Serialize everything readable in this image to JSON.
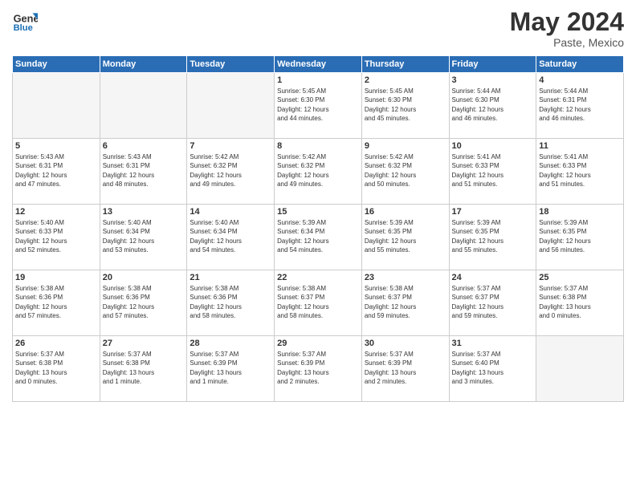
{
  "header": {
    "logo_general": "General",
    "logo_blue": "Blue",
    "month_year": "May 2024",
    "location": "Paste, Mexico"
  },
  "days_of_week": [
    "Sunday",
    "Monday",
    "Tuesday",
    "Wednesday",
    "Thursday",
    "Friday",
    "Saturday"
  ],
  "weeks": [
    [
      {
        "day": "",
        "info": ""
      },
      {
        "day": "",
        "info": ""
      },
      {
        "day": "",
        "info": ""
      },
      {
        "day": "1",
        "info": "Sunrise: 5:45 AM\nSunset: 6:30 PM\nDaylight: 12 hours\nand 44 minutes."
      },
      {
        "day": "2",
        "info": "Sunrise: 5:45 AM\nSunset: 6:30 PM\nDaylight: 12 hours\nand 45 minutes."
      },
      {
        "day": "3",
        "info": "Sunrise: 5:44 AM\nSunset: 6:30 PM\nDaylight: 12 hours\nand 46 minutes."
      },
      {
        "day": "4",
        "info": "Sunrise: 5:44 AM\nSunset: 6:31 PM\nDaylight: 12 hours\nand 46 minutes."
      }
    ],
    [
      {
        "day": "5",
        "info": "Sunrise: 5:43 AM\nSunset: 6:31 PM\nDaylight: 12 hours\nand 47 minutes."
      },
      {
        "day": "6",
        "info": "Sunrise: 5:43 AM\nSunset: 6:31 PM\nDaylight: 12 hours\nand 48 minutes."
      },
      {
        "day": "7",
        "info": "Sunrise: 5:42 AM\nSunset: 6:32 PM\nDaylight: 12 hours\nand 49 minutes."
      },
      {
        "day": "8",
        "info": "Sunrise: 5:42 AM\nSunset: 6:32 PM\nDaylight: 12 hours\nand 49 minutes."
      },
      {
        "day": "9",
        "info": "Sunrise: 5:42 AM\nSunset: 6:32 PM\nDaylight: 12 hours\nand 50 minutes."
      },
      {
        "day": "10",
        "info": "Sunrise: 5:41 AM\nSunset: 6:33 PM\nDaylight: 12 hours\nand 51 minutes."
      },
      {
        "day": "11",
        "info": "Sunrise: 5:41 AM\nSunset: 6:33 PM\nDaylight: 12 hours\nand 51 minutes."
      }
    ],
    [
      {
        "day": "12",
        "info": "Sunrise: 5:40 AM\nSunset: 6:33 PM\nDaylight: 12 hours\nand 52 minutes."
      },
      {
        "day": "13",
        "info": "Sunrise: 5:40 AM\nSunset: 6:34 PM\nDaylight: 12 hours\nand 53 minutes."
      },
      {
        "day": "14",
        "info": "Sunrise: 5:40 AM\nSunset: 6:34 PM\nDaylight: 12 hours\nand 54 minutes."
      },
      {
        "day": "15",
        "info": "Sunrise: 5:39 AM\nSunset: 6:34 PM\nDaylight: 12 hours\nand 54 minutes."
      },
      {
        "day": "16",
        "info": "Sunrise: 5:39 AM\nSunset: 6:35 PM\nDaylight: 12 hours\nand 55 minutes."
      },
      {
        "day": "17",
        "info": "Sunrise: 5:39 AM\nSunset: 6:35 PM\nDaylight: 12 hours\nand 55 minutes."
      },
      {
        "day": "18",
        "info": "Sunrise: 5:39 AM\nSunset: 6:35 PM\nDaylight: 12 hours\nand 56 minutes."
      }
    ],
    [
      {
        "day": "19",
        "info": "Sunrise: 5:38 AM\nSunset: 6:36 PM\nDaylight: 12 hours\nand 57 minutes."
      },
      {
        "day": "20",
        "info": "Sunrise: 5:38 AM\nSunset: 6:36 PM\nDaylight: 12 hours\nand 57 minutes."
      },
      {
        "day": "21",
        "info": "Sunrise: 5:38 AM\nSunset: 6:36 PM\nDaylight: 12 hours\nand 58 minutes."
      },
      {
        "day": "22",
        "info": "Sunrise: 5:38 AM\nSunset: 6:37 PM\nDaylight: 12 hours\nand 58 minutes."
      },
      {
        "day": "23",
        "info": "Sunrise: 5:38 AM\nSunset: 6:37 PM\nDaylight: 12 hours\nand 59 minutes."
      },
      {
        "day": "24",
        "info": "Sunrise: 5:37 AM\nSunset: 6:37 PM\nDaylight: 12 hours\nand 59 minutes."
      },
      {
        "day": "25",
        "info": "Sunrise: 5:37 AM\nSunset: 6:38 PM\nDaylight: 13 hours\nand 0 minutes."
      }
    ],
    [
      {
        "day": "26",
        "info": "Sunrise: 5:37 AM\nSunset: 6:38 PM\nDaylight: 13 hours\nand 0 minutes."
      },
      {
        "day": "27",
        "info": "Sunrise: 5:37 AM\nSunset: 6:38 PM\nDaylight: 13 hours\nand 1 minute."
      },
      {
        "day": "28",
        "info": "Sunrise: 5:37 AM\nSunset: 6:39 PM\nDaylight: 13 hours\nand 1 minute."
      },
      {
        "day": "29",
        "info": "Sunrise: 5:37 AM\nSunset: 6:39 PM\nDaylight: 13 hours\nand 2 minutes."
      },
      {
        "day": "30",
        "info": "Sunrise: 5:37 AM\nSunset: 6:39 PM\nDaylight: 13 hours\nand 2 minutes."
      },
      {
        "day": "31",
        "info": "Sunrise: 5:37 AM\nSunset: 6:40 PM\nDaylight: 13 hours\nand 3 minutes."
      },
      {
        "day": "",
        "info": ""
      }
    ]
  ]
}
